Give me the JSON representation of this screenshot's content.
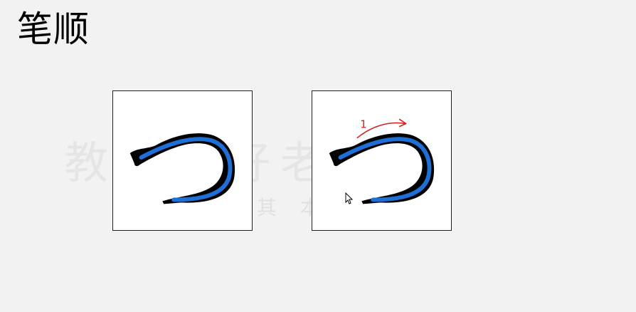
{
  "title": "笔顺",
  "watermark": {
    "line1": "教学的好老师",
    "line2": "定 其 本人"
  },
  "stroke_order": {
    "stroke_number": "1",
    "character": "つ",
    "guide_color": "#1e6fd6",
    "arrow_color": "#d62020"
  }
}
